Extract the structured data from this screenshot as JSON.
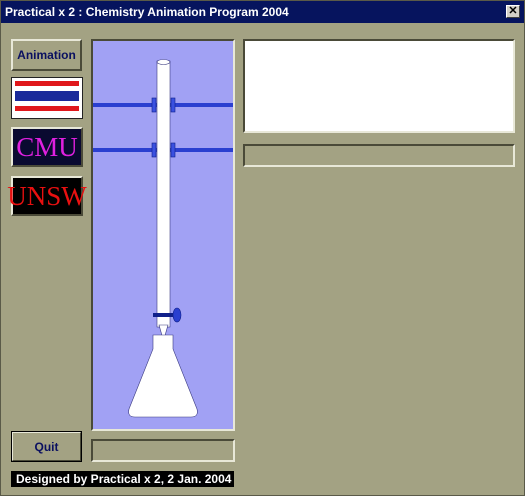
{
  "window": {
    "title": "Practical x 2 : Chemistry Animation Program 2004",
    "close_glyph": "✕"
  },
  "sidebar": {
    "animation_label": "Animation",
    "thai_flag_icon": "thai-flag",
    "cmu_logo": "CMU",
    "unsw_logo": "UNSW",
    "quit_label": "Quit"
  },
  "credit": "Designed by Practical x 2, 2 Jan. 2004",
  "display": {
    "text": ""
  },
  "status": {
    "text": ""
  },
  "stage_status": {
    "text": ""
  },
  "colors": {
    "window_bg": "#a3a283",
    "titlebar": "#06145e",
    "stage_bg": "#a1a1f4",
    "clamp": "#2a3fd0",
    "apparatus": "#ffffff"
  }
}
